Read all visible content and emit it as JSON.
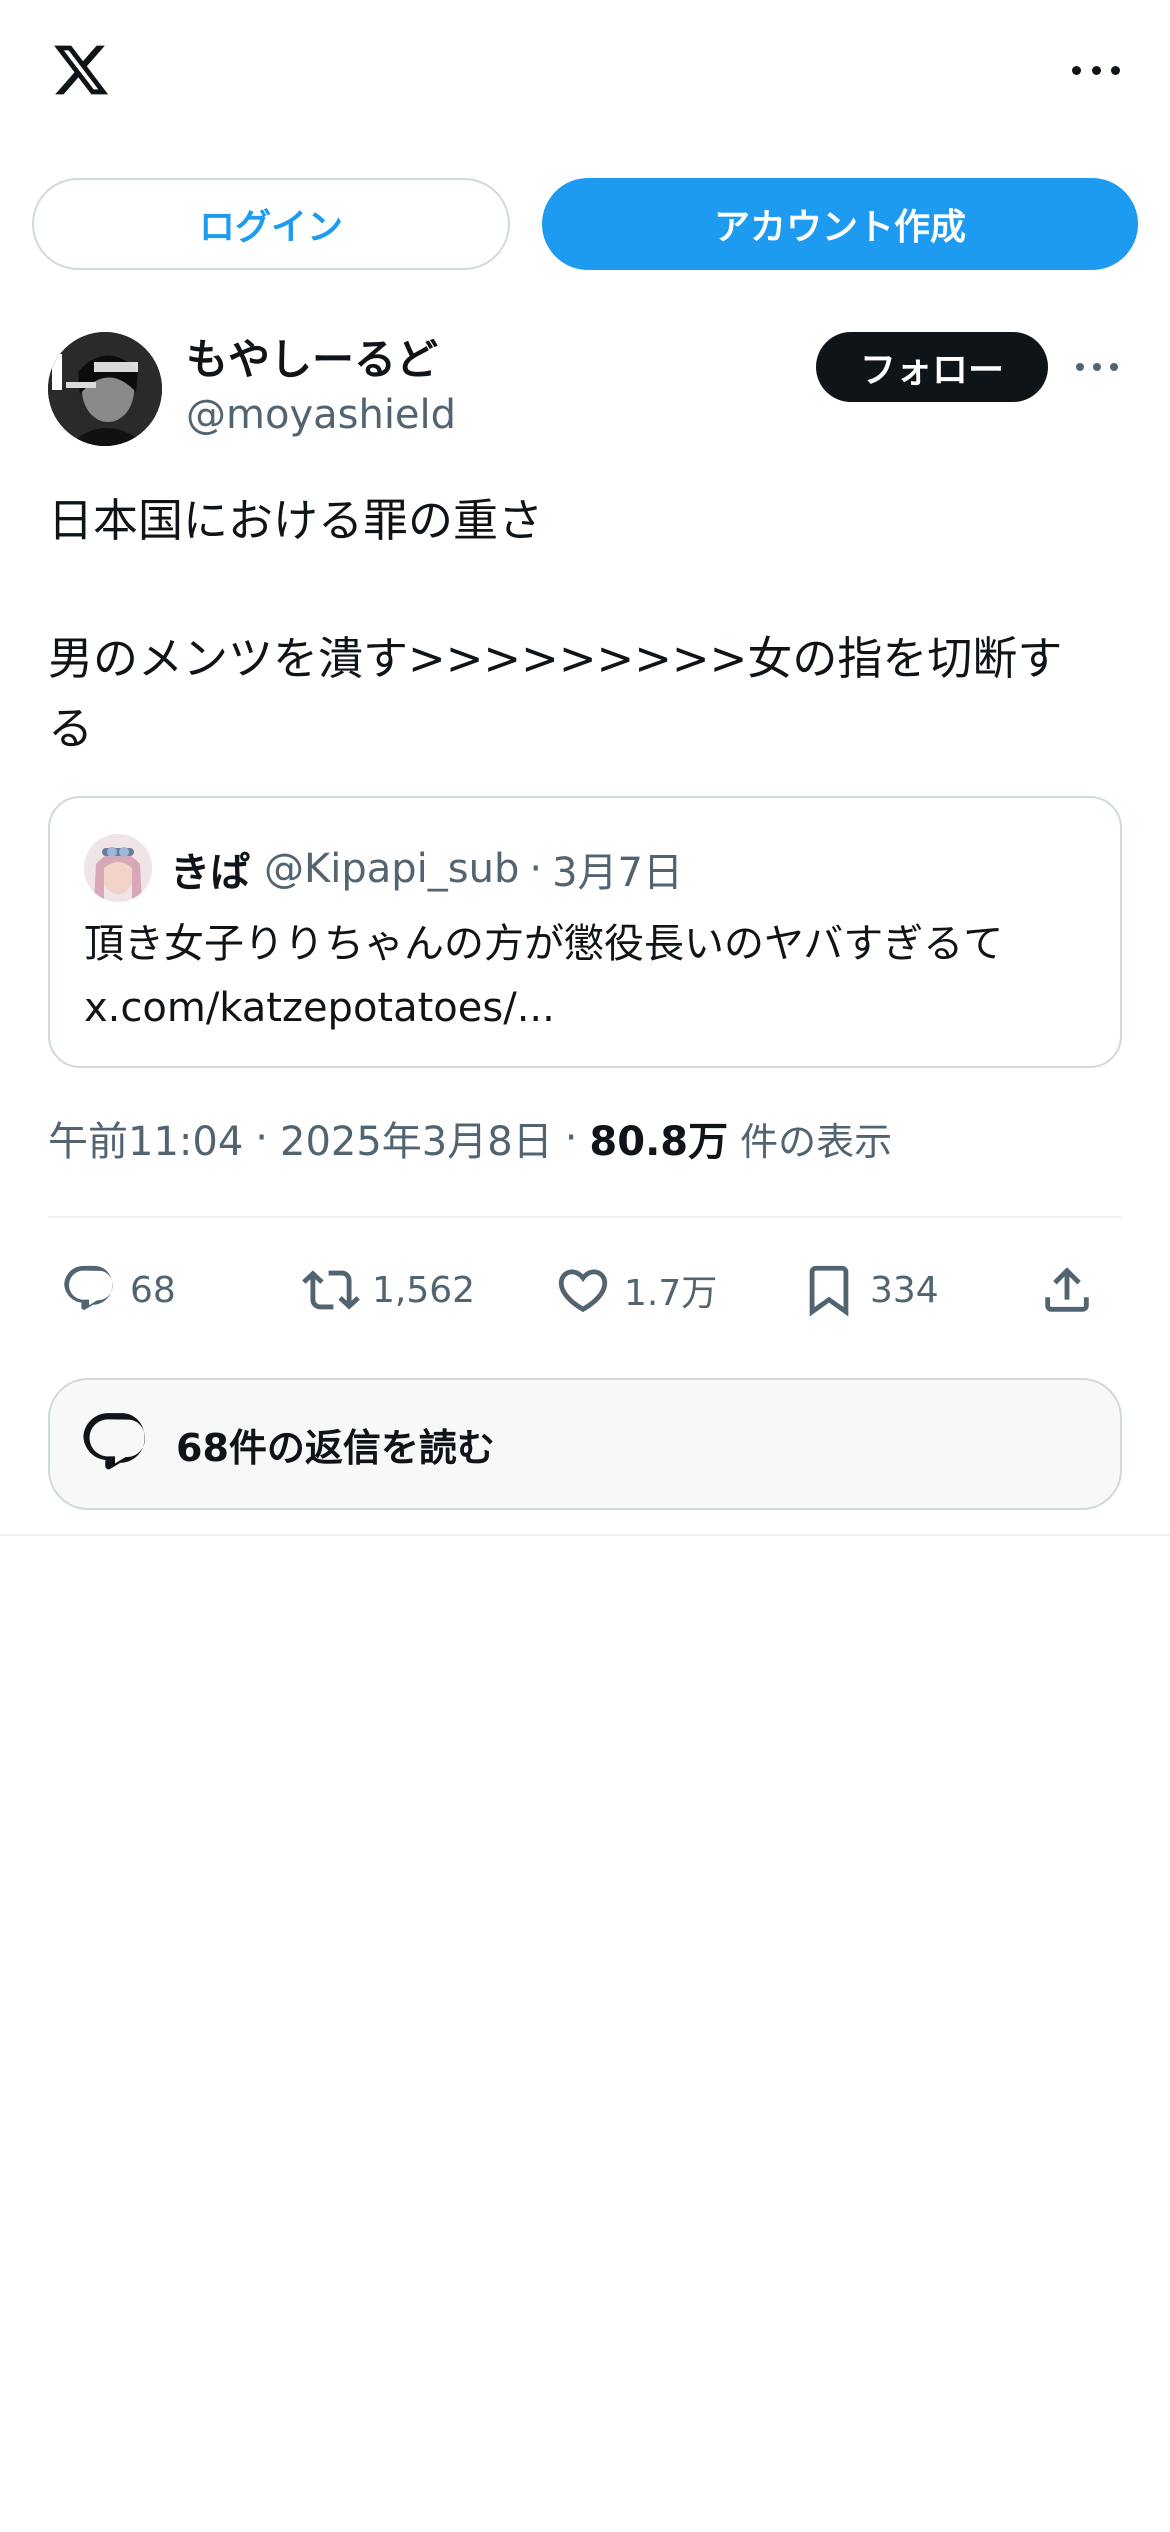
{
  "header": {
    "logo_icon": "x-logo-icon",
    "more_icon": "more-horizontal-icon"
  },
  "auth": {
    "login_label": "ログイン",
    "signup_label": "アカウント作成"
  },
  "tweet": {
    "author_name": "もやしーるど",
    "author_handle": "@moyashield",
    "follow_label": "フォロー",
    "text_line1": "日本国における罪の重さ",
    "text_line2": "男のメンツを潰す>>>>>>>>>女の指を切断す",
    "text_line3": "る",
    "quote": {
      "name": "きぱ",
      "handle": "@Kipapi_sub",
      "separator": "·",
      "date": "3月7日",
      "text_line1": "頂き女子りりちゃんの方が懲役長いのヤバすぎるて",
      "text_line2": "x.com/katzepotatoes/..."
    },
    "meta": {
      "time": "午前11:04",
      "sep1": "·",
      "date": "2025年3月8日",
      "sep2": "·",
      "views": "80.8万",
      "views_label": "件の表示"
    },
    "actions": {
      "reply_count": "68",
      "retweet_count": "1,562",
      "like_count": "1.7万",
      "bookmark_count": "334"
    },
    "read_replies_label": "68件の返信を読む"
  },
  "colors": {
    "accent": "#1d9bf0",
    "text": "#0f1419",
    "secondary_text": "#536471",
    "border": "#cfd9de"
  }
}
